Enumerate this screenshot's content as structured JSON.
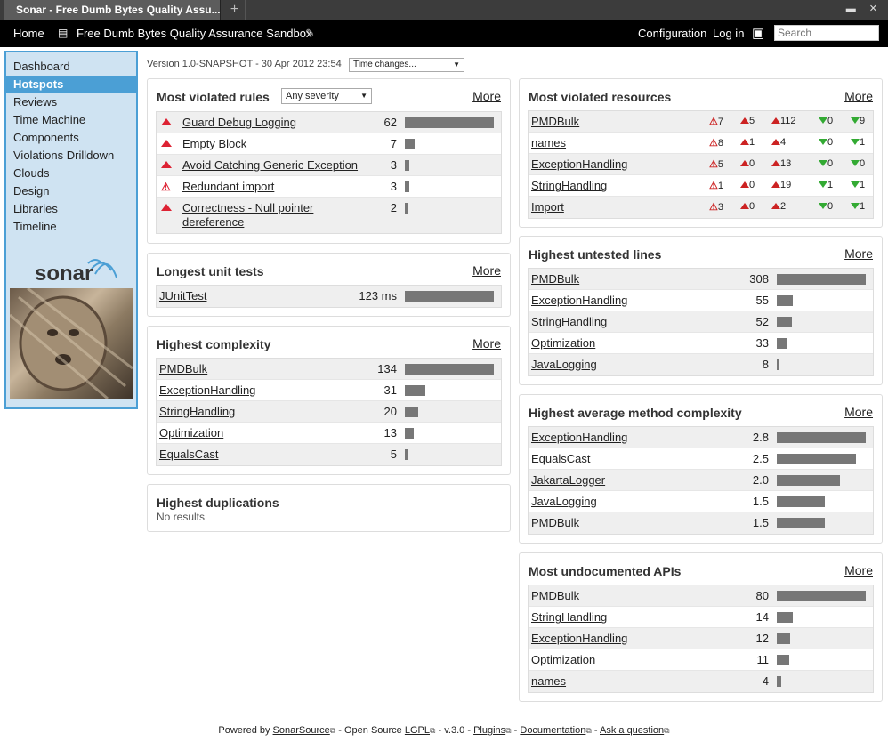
{
  "browser": {
    "tab_title": "Sonar - Free Dumb Bytes Quality Assu...",
    "new_tab": "+"
  },
  "topnav": {
    "home": "Home",
    "project": "Free Dumb Bytes Quality Assurance Sandbox",
    "configuration": "Configuration",
    "login": "Log in",
    "search_placeholder": "Search"
  },
  "sidebar": {
    "items": [
      {
        "label": "Dashboard"
      },
      {
        "label": "Hotspots",
        "active": true
      },
      {
        "label": "Reviews"
      },
      {
        "label": "Time Machine"
      },
      {
        "label": "Components"
      },
      {
        "label": "Violations Drilldown"
      },
      {
        "label": "Clouds"
      },
      {
        "label": "Design"
      },
      {
        "label": "Libraries"
      },
      {
        "label": "Timeline"
      }
    ],
    "logo": "sonar"
  },
  "header": {
    "version": "Version 1.0-SNAPSHOT - 30 Apr 2012 23:54",
    "time_changes": "Time changes..."
  },
  "more": "More",
  "violated_rules": {
    "title": "Most violated rules",
    "severity": "Any severity",
    "rows": [
      {
        "name": "Guard Debug Logging",
        "value": "62",
        "fraction": 1.0,
        "icon": "major"
      },
      {
        "name": "Empty Block",
        "value": "7",
        "fraction": 0.11,
        "icon": "major"
      },
      {
        "name": "Avoid Catching Generic Exception",
        "value": "3",
        "fraction": 0.05,
        "icon": "major"
      },
      {
        "name": "Redundant import",
        "value": "3",
        "fraction": 0.05,
        "icon": "warning"
      },
      {
        "name": "Correctness - Null pointer",
        "name2": "dereference",
        "value": "2",
        "fraction": 0.03,
        "icon": "major"
      }
    ]
  },
  "unit_tests": {
    "title": "Longest unit tests",
    "rows": [
      {
        "name": "JUnitTest",
        "value": "123 ms",
        "fraction": 1.0
      }
    ]
  },
  "complexity": {
    "title": "Highest complexity",
    "rows": [
      {
        "name": "PMDBulk",
        "value": "134",
        "fraction": 1.0
      },
      {
        "name": "ExceptionHandling",
        "value": "31",
        "fraction": 0.23
      },
      {
        "name": "StringHandling",
        "value": "20",
        "fraction": 0.15
      },
      {
        "name": "Optimization",
        "value": "13",
        "fraction": 0.1
      },
      {
        "name": "EqualsCast",
        "value": "5",
        "fraction": 0.04
      }
    ]
  },
  "duplications": {
    "title": "Highest duplications",
    "empty": "No results"
  },
  "violated_resources": {
    "title": "Most violated resources",
    "rows": [
      {
        "name": "PMDBulk",
        "v": [
          "7",
          "5",
          "112",
          "0",
          "9"
        ]
      },
      {
        "name": "names",
        "v": [
          "8",
          "1",
          "4",
          "0",
          "1"
        ]
      },
      {
        "name": "ExceptionHandling",
        "v": [
          "5",
          "0",
          "13",
          "0",
          "0"
        ]
      },
      {
        "name": "StringHandling",
        "v": [
          "1",
          "0",
          "19",
          "1",
          "1"
        ]
      },
      {
        "name": "Import",
        "v": [
          "3",
          "0",
          "2",
          "0",
          "1"
        ]
      }
    ]
  },
  "untested": {
    "title": "Highest untested lines",
    "rows": [
      {
        "name": "PMDBulk",
        "value": "308",
        "fraction": 1.0
      },
      {
        "name": "ExceptionHandling",
        "value": "55",
        "fraction": 0.18
      },
      {
        "name": "StringHandling",
        "value": "52",
        "fraction": 0.17
      },
      {
        "name": "Optimization",
        "value": "33",
        "fraction": 0.11
      },
      {
        "name": "JavaLogging",
        "value": "8",
        "fraction": 0.03
      }
    ]
  },
  "method_complexity": {
    "title": "Highest average method complexity",
    "rows": [
      {
        "name": "ExceptionHandling",
        "value": "2.8",
        "fraction": 1.0
      },
      {
        "name": "EqualsCast",
        "value": "2.5",
        "fraction": 0.89
      },
      {
        "name": "JakartaLogger",
        "value": "2.0",
        "fraction": 0.71
      },
      {
        "name": "JavaLogging",
        "value": "1.5",
        "fraction": 0.54
      },
      {
        "name": "PMDBulk",
        "value": "1.5",
        "fraction": 0.54
      }
    ]
  },
  "undocumented": {
    "title": "Most undocumented APIs",
    "rows": [
      {
        "name": "PMDBulk",
        "value": "80",
        "fraction": 1.0
      },
      {
        "name": "StringHandling",
        "value": "14",
        "fraction": 0.18
      },
      {
        "name": "ExceptionHandling",
        "value": "12",
        "fraction": 0.15
      },
      {
        "name": "Optimization",
        "value": "11",
        "fraction": 0.14
      },
      {
        "name": "names",
        "value": "4",
        "fraction": 0.05
      }
    ]
  },
  "footer": {
    "powered": "Powered by",
    "sonarsource": "SonarSource",
    "open_source": "- Open Source",
    "lgpl": "LGPL",
    "version": "- v.3.0 -",
    "plugins": "Plugins",
    "sep1": "-",
    "documentation": "Documentation",
    "sep2": "-",
    "ask": "Ask a question"
  }
}
